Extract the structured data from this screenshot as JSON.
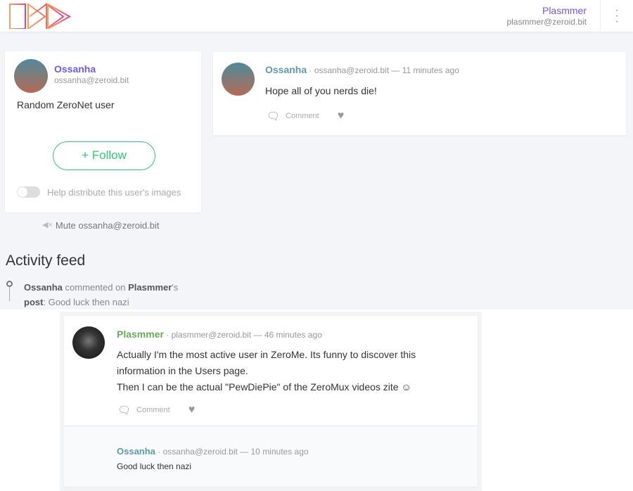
{
  "header": {
    "user_name": "Plasmmer",
    "user_email": "plasmmer@zeroid.bit",
    "logo_text": "ZeroMe"
  },
  "profile": {
    "name": "Ossanha",
    "email": "ossanha@zeroid.bit",
    "intro": "Random ZeroNet user",
    "follow_label": "+ Follow",
    "distribute_label": "Help distribute this user's images",
    "mute_label": "Mute ossanha@zeroid.bit"
  },
  "post": {
    "author": "Ossanha",
    "meta": "· ossanha@zeroid.bit — 11 minutes ago",
    "body": "Hope all of you nerds die!",
    "comment_label": "Comment"
  },
  "activity": {
    "title": "Activity feed",
    "actor": "Ossanha",
    "verb": " commented on ",
    "target": "Plasmmer",
    "suffix": "'s",
    "post_word": "post",
    "text": ": Good luck then nazi"
  },
  "feed_post": {
    "author": "Plasmmer",
    "meta": "· plasmmer@zeroid.bit — 46 minutes ago",
    "line1": "Actually I'm the most active user in ZeroMe. Its funny to discover this",
    "line2": "information in the Users page.",
    "line3": "Then I can be the actual \"PewDiePie\" of the ZeroMux videos zite ☺",
    "comment_label": "Comment",
    "comment": {
      "author": "Ossanha",
      "meta": "· ossanha@zeroid.bit — 10 minutes ago",
      "body": "Good luck then nazi"
    }
  },
  "colors": {
    "accent": "#6c5ce7",
    "follow": "#2ecc71",
    "ossanha": "#5b9bb0",
    "plasmmer": "#6aaa5a"
  }
}
